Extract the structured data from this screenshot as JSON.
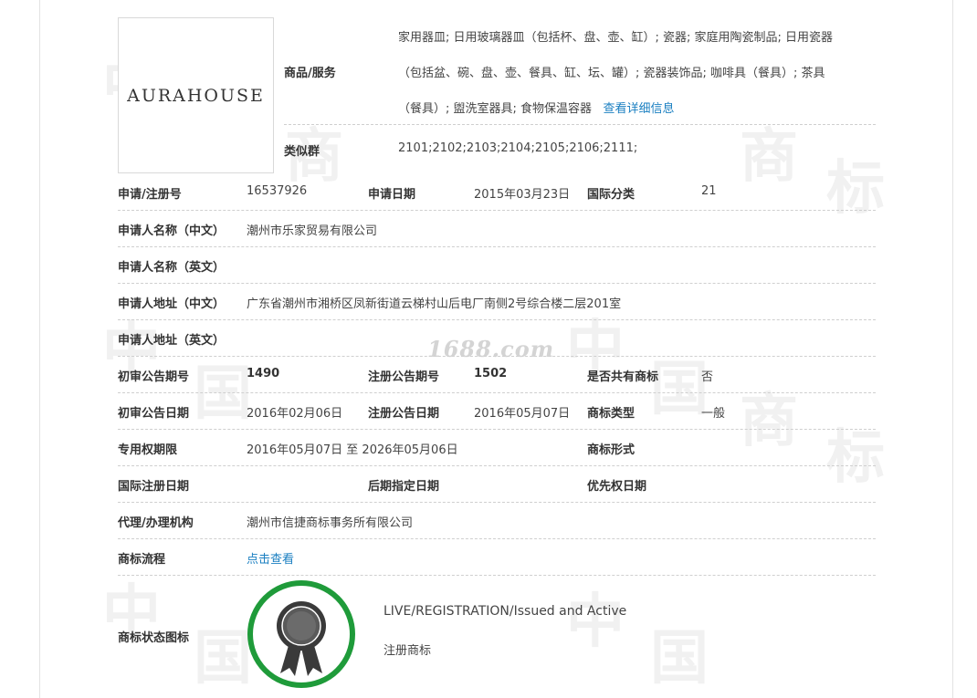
{
  "logo": {
    "text": "AURAHOUSE"
  },
  "watermark": {
    "site": "1688.com"
  },
  "goods": {
    "label": "商品/服务",
    "lines": [
      "家用器皿; 日用玻璃器皿（包括杯、盘、壶、缸）; 瓷器; 家庭用陶瓷制品; 日用瓷器",
      "（包括盆、碗、盘、壶、餐具、缸、坛、罐）; 瓷器装饰品; 咖啡具（餐具）; 茶具",
      "（餐具）; 盥洗室器具; 食物保温容器"
    ],
    "detail_link": "查看详细信息"
  },
  "similar": {
    "label": "类似群",
    "value": "2101;2102;2103;2104;2105;2106;2111;"
  },
  "reg": {
    "no_label": "申请/注册号",
    "no_value": "16537926",
    "date_label": "申请日期",
    "date_value": "2015年03月23日",
    "intl_label": "国际分类",
    "intl_value": "21"
  },
  "applicant": {
    "name_cn_label": "申请人名称（中文）",
    "name_cn_value": "潮州市乐家贸易有限公司",
    "name_en_label": "申请人名称（英文）",
    "name_en_value": "",
    "addr_cn_label": "申请人地址（中文）",
    "addr_cn_value": "广东省潮州市湘桥区凤新街道云梯村山后电厂南侧2号综合楼二层201室",
    "addr_en_label": "申请人地址（英文）",
    "addr_en_value": ""
  },
  "announce": {
    "prelim_no_label": "初审公告期号",
    "prelim_no_value": "1490",
    "reg_no_label": "注册公告期号",
    "reg_no_value": "1502",
    "shared_label": "是否共有商标",
    "shared_value": "否",
    "prelim_date_label": "初审公告日期",
    "prelim_date_value": "2016年02月06日",
    "reg_date_label": "注册公告日期",
    "reg_date_value": "2016年05月07日",
    "type_label": "商标类型",
    "type_value": "一般"
  },
  "rights": {
    "period_label": "专用权期限",
    "period_value": "2016年05月07日 至 2026年05月06日",
    "form_label": "商标形式",
    "form_value": ""
  },
  "intl": {
    "reg_date_label": "国际注册日期",
    "reg_date_value": "",
    "later_label": "后期指定日期",
    "later_value": "",
    "priority_label": "优先权日期",
    "priority_value": ""
  },
  "agent": {
    "label": "代理/办理机构",
    "value": "潮州市信捷商标事务所有限公司"
  },
  "process": {
    "label": "商标流程",
    "link": "点击查看"
  },
  "status": {
    "label": "商标状态图标",
    "en": "LIVE/REGISTRATION/Issued and Active",
    "cn": "注册商标",
    "ring_color": "#1f9b3a",
    "icon": "rosette-award-icon"
  }
}
